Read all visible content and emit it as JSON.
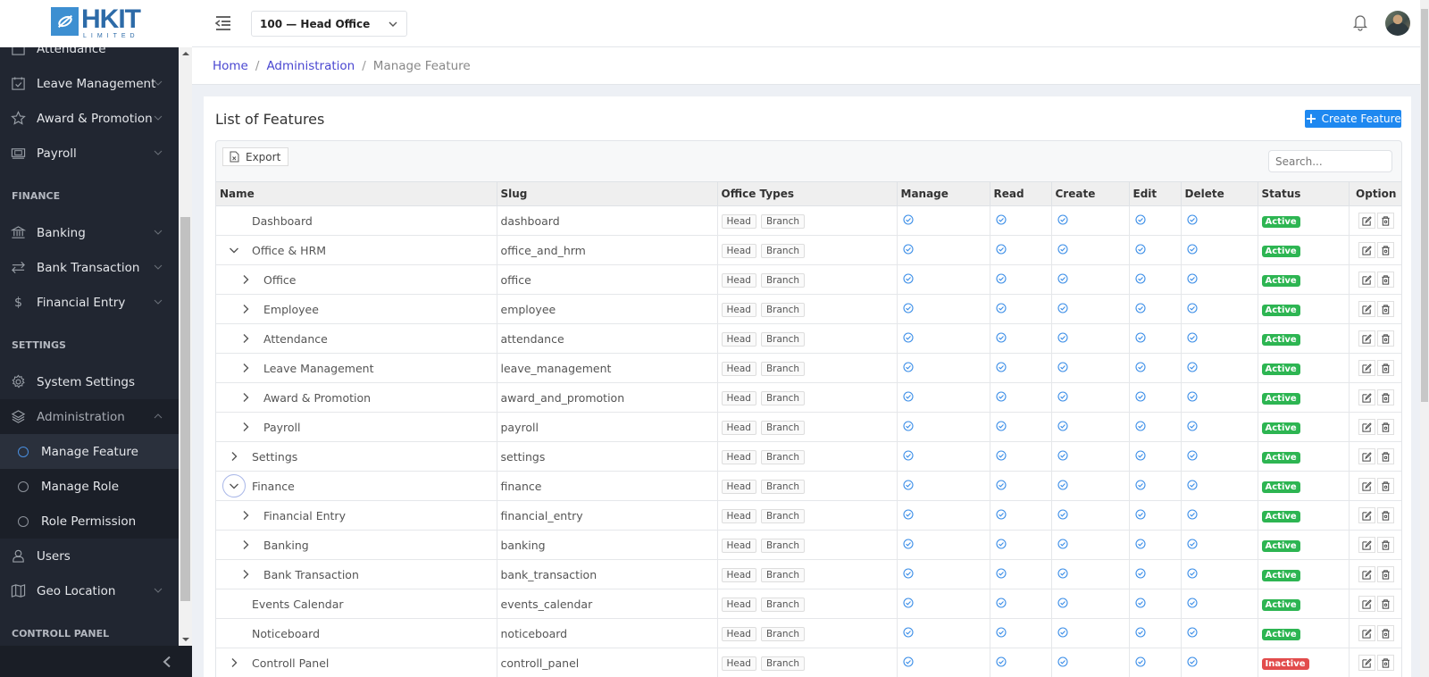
{
  "brand": {
    "name": "HKIT",
    "tagline": "LIMITED",
    "color": "#3d8fd1"
  },
  "header": {
    "office_select": "100 — Head Office",
    "notifications_icon": "bell-icon",
    "avatar_icon": "user-avatar"
  },
  "sidebar": {
    "partial_item": {
      "label": "Attendance",
      "icon": "calendar-icon"
    },
    "items_top": [
      {
        "label": "Leave Management",
        "icon": "calendar-check-icon"
      },
      {
        "label": "Award & Promotion",
        "icon": "star-icon"
      },
      {
        "label": "Payroll",
        "icon": "money-icon"
      }
    ],
    "section_finance": "FINANCE",
    "items_finance": [
      {
        "label": "Banking",
        "icon": "bank-icon"
      },
      {
        "label": "Bank Transaction",
        "icon": "transfer-icon"
      },
      {
        "label": "Financial Entry",
        "icon": "dollar-icon"
      }
    ],
    "section_settings": "SETTINGS",
    "system_settings": "System Settings",
    "administration": "Administration",
    "admin_sub": [
      {
        "label": "Manage Feature",
        "active": true
      },
      {
        "label": "Manage Role",
        "active": false
      },
      {
        "label": "Role Permission",
        "active": false
      }
    ],
    "users": "Users",
    "geo_location": "Geo Location",
    "section_control": "CONTROLL PANEL"
  },
  "breadcrumb": {
    "home": "Home",
    "admin": "Administration",
    "current": "Manage Feature",
    "separator": "/"
  },
  "page": {
    "title": "List of Features",
    "create_button": "Create Feature",
    "export_button": "Export",
    "search_placeholder": "Search..."
  },
  "table": {
    "columns": [
      "Name",
      "Slug",
      "Office Types",
      "Manage",
      "Read",
      "Create",
      "Edit",
      "Delete",
      "Status",
      "Option"
    ],
    "rows": [
      {
        "name": "Dashboard",
        "slug": "dashboard",
        "level": 0,
        "expander": "none",
        "office_types": [
          "Head",
          "Branch"
        ],
        "perms": [
          true,
          true,
          true,
          true,
          true
        ],
        "status": "Active"
      },
      {
        "name": "Office & HRM",
        "slug": "office_and_hrm",
        "level": 0,
        "expander": "expanded",
        "office_types": [
          "Head",
          "Branch"
        ],
        "perms": [
          true,
          true,
          true,
          true,
          true
        ],
        "status": "Active"
      },
      {
        "name": "Office",
        "slug": "office",
        "level": 1,
        "expander": "collapsed",
        "office_types": [
          "Head",
          "Branch"
        ],
        "perms": [
          true,
          true,
          true,
          true,
          true
        ],
        "status": "Active"
      },
      {
        "name": "Employee",
        "slug": "employee",
        "level": 1,
        "expander": "collapsed",
        "office_types": [
          "Head",
          "Branch"
        ],
        "perms": [
          true,
          true,
          true,
          true,
          true
        ],
        "status": "Active"
      },
      {
        "name": "Attendance",
        "slug": "attendance",
        "level": 1,
        "expander": "collapsed",
        "office_types": [
          "Head",
          "Branch"
        ],
        "perms": [
          true,
          true,
          true,
          true,
          true
        ],
        "status": "Active"
      },
      {
        "name": "Leave Management",
        "slug": "leave_management",
        "level": 1,
        "expander": "collapsed",
        "office_types": [
          "Head",
          "Branch"
        ],
        "perms": [
          true,
          true,
          true,
          true,
          true
        ],
        "status": "Active"
      },
      {
        "name": "Award & Promotion",
        "slug": "award_and_promotion",
        "level": 1,
        "expander": "collapsed",
        "office_types": [
          "Head",
          "Branch"
        ],
        "perms": [
          true,
          true,
          true,
          true,
          true
        ],
        "status": "Active"
      },
      {
        "name": "Payroll",
        "slug": "payroll",
        "level": 1,
        "expander": "collapsed",
        "office_types": [
          "Head",
          "Branch"
        ],
        "perms": [
          true,
          true,
          true,
          true,
          true
        ],
        "status": "Active"
      },
      {
        "name": "Settings",
        "slug": "settings",
        "level": 0,
        "expander": "collapsed",
        "office_types": [
          "Head",
          "Branch"
        ],
        "perms": [
          true,
          true,
          true,
          true,
          true
        ],
        "status": "Active"
      },
      {
        "name": "Finance",
        "slug": "finance",
        "level": 0,
        "expander": "expanded-focus",
        "office_types": [
          "Head",
          "Branch"
        ],
        "perms": [
          true,
          true,
          true,
          true,
          true
        ],
        "status": "Active"
      },
      {
        "name": "Financial Entry",
        "slug": "financial_entry",
        "level": 1,
        "expander": "collapsed",
        "office_types": [
          "Head",
          "Branch"
        ],
        "perms": [
          true,
          true,
          true,
          true,
          true
        ],
        "status": "Active"
      },
      {
        "name": "Banking",
        "slug": "banking",
        "level": 1,
        "expander": "collapsed",
        "office_types": [
          "Head",
          "Branch"
        ],
        "perms": [
          true,
          true,
          true,
          true,
          true
        ],
        "status": "Active"
      },
      {
        "name": "Bank Transaction",
        "slug": "bank_transaction",
        "level": 1,
        "expander": "collapsed",
        "office_types": [
          "Head",
          "Branch"
        ],
        "perms": [
          true,
          true,
          true,
          true,
          true
        ],
        "status": "Active"
      },
      {
        "name": "Events Calendar",
        "slug": "events_calendar",
        "level": 0,
        "expander": "none",
        "office_types": [
          "Head",
          "Branch"
        ],
        "perms": [
          true,
          true,
          true,
          true,
          true
        ],
        "status": "Active"
      },
      {
        "name": "Noticeboard",
        "slug": "noticeboard",
        "level": 0,
        "expander": "none",
        "office_types": [
          "Head",
          "Branch"
        ],
        "perms": [
          true,
          true,
          true,
          true,
          true
        ],
        "status": "Active"
      },
      {
        "name": "Controll Panel",
        "slug": "controll_panel",
        "level": 0,
        "expander": "collapsed",
        "office_types": [
          "Head",
          "Branch"
        ],
        "perms": [
          true,
          true,
          true,
          true,
          true
        ],
        "status": "Inactive"
      }
    ]
  },
  "colors": {
    "sidebar_bg": "#212631",
    "primary": "#1e88f0",
    "link": "#4a47d1",
    "active": "#2db552",
    "inactive": "#e24c4c",
    "check": "#3b8ee8"
  }
}
